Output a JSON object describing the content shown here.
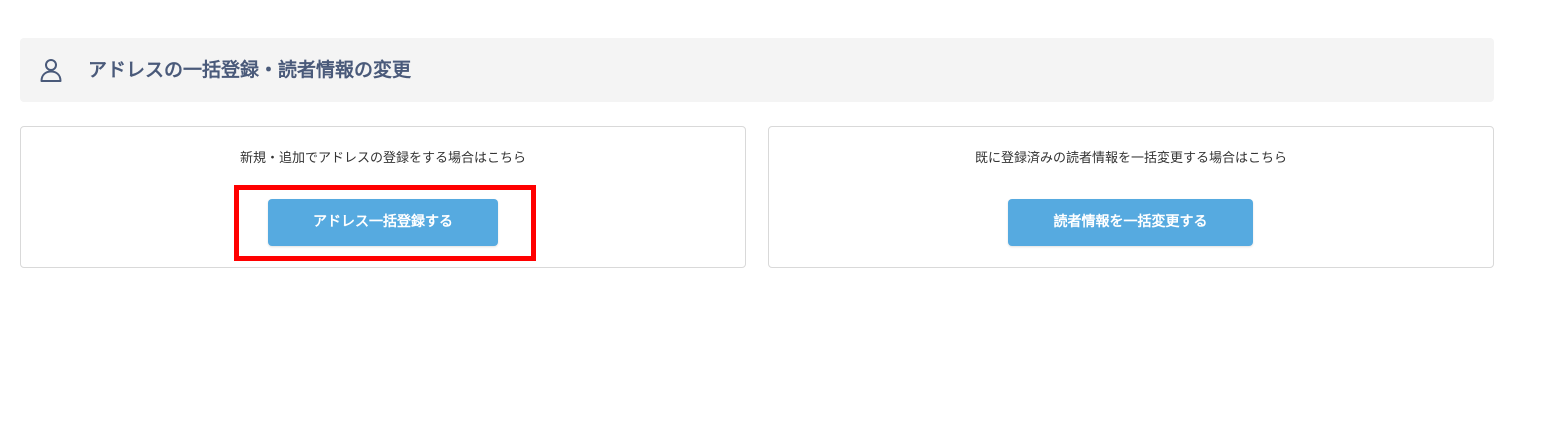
{
  "header": {
    "icon": "user-icon",
    "title": "アドレスの一括登録・読者情報の変更"
  },
  "cards": [
    {
      "description": "新規・追加でアドレスの登録をする場合はこちら",
      "button_label": "アドレス一括登録する"
    },
    {
      "description": "既に登録済みの読者情報を一括変更する場合はこちら",
      "button_label": "読者情報を一括変更する"
    }
  ],
  "colors": {
    "button": "#56aae0",
    "header_bg": "#f4f4f4",
    "title_text": "#4a5a7a",
    "highlight": "#ff0000"
  }
}
